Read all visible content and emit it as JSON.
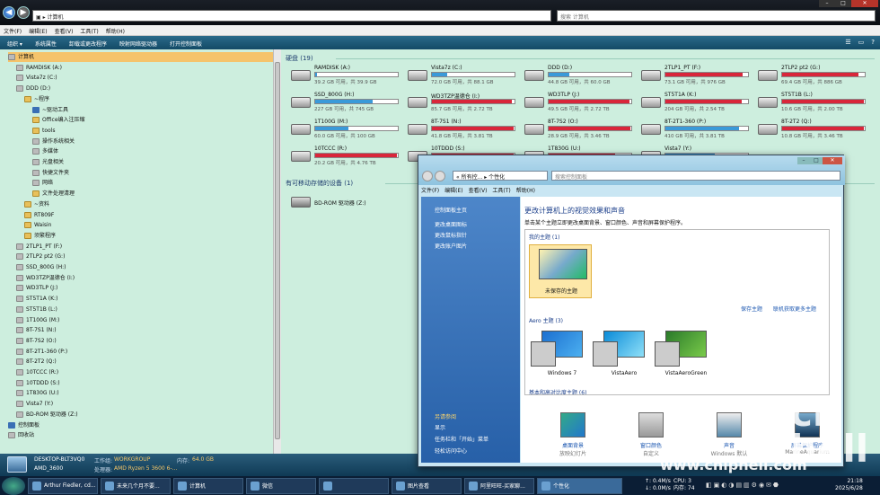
{
  "addressbar": {
    "path": "计算机",
    "search_placeholder": "搜索 计算机"
  },
  "menubar": [
    "文件(F)",
    "编辑(E)",
    "查看(V)",
    "工具(T)",
    "帮助(H)"
  ],
  "toolbar": [
    "组织 ▾",
    "系统属性",
    "卸载或更改程序",
    "映射网络驱动器",
    "打开控制面板"
  ],
  "tree": [
    {
      "label": "计算机",
      "kind": "c",
      "sel": true,
      "indent": 1
    },
    {
      "label": "RAMDISK (A:)",
      "kind": "d",
      "indent": 2
    },
    {
      "label": "Vista7z (C:)",
      "kind": "d",
      "indent": 2
    },
    {
      "label": "DDD (D:)",
      "kind": "d",
      "indent": 2
    },
    {
      "label": "~程序",
      "kind": "f",
      "indent": 3
    },
    {
      "label": "~驱动工具",
      "kind": "b",
      "indent": 4
    },
    {
      "label": "Office编入注压缩",
      "kind": "f",
      "indent": 4
    },
    {
      "label": "tools",
      "kind": "f",
      "indent": 4
    },
    {
      "label": "操作系统相关",
      "kind": "d",
      "indent": 4
    },
    {
      "label": "多媒体",
      "kind": "d",
      "indent": 4
    },
    {
      "label": "光盘相关",
      "kind": "d",
      "indent": 4
    },
    {
      "label": "快捷文件夹",
      "kind": "d",
      "indent": 4
    },
    {
      "label": "网络",
      "kind": "d",
      "indent": 4
    },
    {
      "label": "文件处理清理",
      "kind": "f",
      "indent": 4
    },
    {
      "label": "~资料",
      "kind": "f",
      "indent": 3
    },
    {
      "label": "RT809F",
      "kind": "f",
      "indent": 3
    },
    {
      "label": "Waisin",
      "kind": "f",
      "indent": 3
    },
    {
      "label": "须繁程序",
      "kind": "f",
      "indent": 3
    },
    {
      "label": "2TLP1_PT (F:)",
      "kind": "d",
      "indent": 2
    },
    {
      "label": "2TLP2  pt2 (G:)",
      "kind": "d",
      "indent": 2
    },
    {
      "label": "SSD_800G (H:)",
      "kind": "d",
      "indent": 2
    },
    {
      "label": "WD3TZP温德仓 (I:)",
      "kind": "d",
      "indent": 2
    },
    {
      "label": "WD3TLP (J:)",
      "kind": "d",
      "indent": 2
    },
    {
      "label": "ST5T1A (K:)",
      "kind": "d",
      "indent": 2
    },
    {
      "label": "ST5T1B (L:)",
      "kind": "d",
      "indent": 2
    },
    {
      "label": "1T100G (M:)",
      "kind": "d",
      "indent": 2
    },
    {
      "label": "8T-7S1 (N:)",
      "kind": "d",
      "indent": 2
    },
    {
      "label": "8T-7S2 (O:)",
      "kind": "d",
      "indent": 2
    },
    {
      "label": "8T-2T1-360 (P:)",
      "kind": "d",
      "indent": 2
    },
    {
      "label": "8T-2T2 (Q:)",
      "kind": "d",
      "indent": 2
    },
    {
      "label": "10TCCC (R:)",
      "kind": "d",
      "indent": 2
    },
    {
      "label": "10TDDD (S:)",
      "kind": "d",
      "indent": 2
    },
    {
      "label": "1T830G (U:)",
      "kind": "d",
      "indent": 2
    },
    {
      "label": "Vista7 (Y:)",
      "kind": "d",
      "indent": 2
    },
    {
      "label": "BD-ROM 驱动器 (Z:)",
      "kind": "d",
      "indent": 2
    },
    {
      "label": "控制面板",
      "kind": "b",
      "indent": 1
    },
    {
      "label": "回收站",
      "kind": "d",
      "indent": 1
    }
  ],
  "main": {
    "disks_header": "硬盘 (19)",
    "removable_header": "有可移动存储的设备 (1)",
    "drives": [
      {
        "name": "RAMDISK (A:)",
        "size": "39.2 GB 可用，共 39.9 GB",
        "pct": 2,
        "col": "#3a9ad9"
      },
      {
        "name": "Vista7z (C:)",
        "size": "72.0 GB 可用，共 88.1 GB",
        "pct": 18,
        "col": "#3a9ad9"
      },
      {
        "name": "DDD (D:)",
        "size": "44.8 GB 可用，共 60.0 GB",
        "pct": 25,
        "col": "#3a9ad9"
      },
      {
        "name": "2TLP1_PT (F:)",
        "size": "73.1 GB 可用，共 976 GB",
        "pct": 93,
        "col": "#d9263a"
      },
      {
        "name": "2TLP2  pt2 (G:)",
        "size": "69.4 GB 可用，共 886 GB",
        "pct": 92,
        "col": "#d9263a"
      },
      {
        "name": "SSD_800G (H:)",
        "size": "227 GB 可用，共 745 GB",
        "pct": 70,
        "col": "#3a9ad9"
      },
      {
        "name": "WD3TZP温德仓 (I:)",
        "size": "85.7 GB 可用，共 2.72 TB",
        "pct": 97,
        "col": "#d9263a"
      },
      {
        "name": "WD3TLP (J:)",
        "size": "49.5 GB 可用，共 2.72 TB",
        "pct": 98,
        "col": "#d9263a"
      },
      {
        "name": "ST5T1A (K:)",
        "size": "204 GB 可用，共 2.54 TB",
        "pct": 92,
        "col": "#d9263a"
      },
      {
        "name": "ST5T1B (L:)",
        "size": "10.6 GB 可用，共 2.00 TB",
        "pct": 99,
        "col": "#d9263a"
      },
      {
        "name": "1T100G (M:)",
        "size": "60.0 GB 可用，共 100 GB",
        "pct": 40,
        "col": "#3a9ad9"
      },
      {
        "name": "8T-7S1 (N:)",
        "size": "41.8 GB 可用，共 3.81 TB",
        "pct": 99,
        "col": "#d9263a"
      },
      {
        "name": "8T-7S2 (O:)",
        "size": "28.9 GB 可用，共 3.46 TB",
        "pct": 99,
        "col": "#d9263a"
      },
      {
        "name": "8T-2T1-360 (P:)",
        "size": "410 GB 可用，共 3.81 TB",
        "pct": 89,
        "col": "#3a9ad9"
      },
      {
        "name": "8T-2T2 (Q:)",
        "size": "10.8 GB 可用，共 3.46 TB",
        "pct": 99,
        "col": "#d9263a"
      },
      {
        "name": "10TCCC (R:)",
        "size": "20.2 GB 可用，共 4.76 TB",
        "pct": 99,
        "col": "#d9263a"
      },
      {
        "name": "10TDDD (S:)",
        "size": "",
        "pct": 99,
        "col": "#d9263a"
      },
      {
        "name": "1T830G (U:)",
        "size": "",
        "pct": 80,
        "col": "#d9263a"
      },
      {
        "name": "Vista7 (Y:)",
        "size": "",
        "pct": 60,
        "col": "#3a9ad9"
      }
    ],
    "bdrom": "BD-ROM 驱动器 (Z:)"
  },
  "status": {
    "computer": "DESKTOP-BLT3VQ0",
    "workgroup_label": "工作组:",
    "workgroup": "WORKGROUP",
    "memory_label": "内存:",
    "memory": "64.0 GB",
    "cpu_label": "处理器:",
    "cpu": "AMD Ryzen 5 3600 6-...",
    "cpu_short": "AMD_3600"
  },
  "dialog": {
    "path": "« 所有控... ▸ 个性化",
    "search_placeholder": "搜索控制面板",
    "menu": [
      "文件(F)",
      "编辑(E)",
      "查看(V)",
      "工具(T)",
      "帮助(H)"
    ],
    "left_links": [
      "控制面板主页",
      "更改桌面图标",
      "更改鼠标指针",
      "更改账户图片"
    ],
    "see_also_label": "另请参阅",
    "see_also": [
      "显示",
      "任务栏和「开始」菜单",
      "轻松访问中心"
    ],
    "title": "更改计算机上的视觉效果和声音",
    "subtitle": "单击某个主题立即更改桌面背景、窗口颜色、声音和屏幕保护程序。",
    "my_themes": "我的主题 (1)",
    "unsaved": "未保存的主题",
    "save_theme": "保存主题",
    "get_more": "联机获取更多主题",
    "aero_themes": "Aero 主题 (3)",
    "themes": [
      "Windows 7",
      "VistaAero",
      "VistaAeroGreen"
    ],
    "basic_themes": "基本和高对比度主题 (6)",
    "bottom": [
      {
        "title": "桌面背景",
        "sub": "放映幻灯片"
      },
      {
        "title": "窗口颜色",
        "sub": "自定义"
      },
      {
        "title": "声音",
        "sub": "Windows 默认"
      },
      {
        "title": "屏幕保护程序",
        "sub": "MarineAquarium"
      }
    ]
  },
  "taskbar": {
    "items": [
      "Arthur Fiedler, cd...",
      "未来几个月不要...",
      "计算机",
      "微信",
      "",
      "图片查看",
      "阿里旺旺-买家聊...",
      "个性化"
    ],
    "net_up": "↑: 0.4M/s",
    "net_dn": "↓: 0.0M/s",
    "cpu": "CPU: 3",
    "mem": "内存: 74",
    "time": "21:18",
    "date": "2025/6/28"
  },
  "watermark": "www.chiphell.com"
}
